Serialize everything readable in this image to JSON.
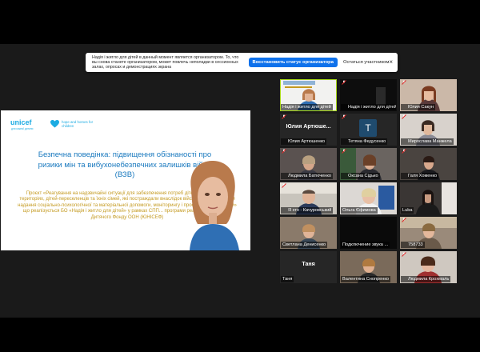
{
  "banner": {
    "message": "Надія і житло для дітей в данный момент является организатором. То, что вы снова станете организатором, может повлечь неполадки в сессионных залах, опросах и демонстрациях экрана",
    "reclaim_host_label": "Восстановить статус организатора",
    "remain_participant_label": "Остаться участником",
    "close_glyph": "×"
  },
  "slide": {
    "unicef_logo": "unicef",
    "unicef_sub": "для кожної дитини",
    "hope_logo": "hope and homes for children",
    "title": "Безпечна поведінка: підвищення обізнаності про ризики мін та вибухонебезпечних залишків війни (ВЗВ)",
    "body_1": "Проєкт «Реагування на надзвичайні ситуації для забезпечення потреб дітей на звільнених територіях, дітей-переселенців та їхніх сімей, які постраждали внаслідок військових дій, шляхом надання соціально-психологічної та матеріальної допомоги, моніторингу і просування прав дітей»",
    "body_2": "що реалізується БО «Надія і житло для дітей» у рамках СПП... програми реагування на війну Дитячого Фонду ООН (ЮНІСЕФ)"
  },
  "participants": [
    {
      "label": "Надія і житло для дітей",
      "muted": false,
      "kind": "video"
    },
    {
      "label": "Надія і житло для дітей",
      "muted": true,
      "kind": "video"
    },
    {
      "label": "Юлия Сакун",
      "muted": true,
      "kind": "video"
    },
    {
      "label": "Юлия Артюшенко",
      "muted": true,
      "kind": "name",
      "display": "Юлия Артюше..."
    },
    {
      "label": "Тетяна Федусенко",
      "muted": true,
      "kind": "avatar",
      "initial": "Т"
    },
    {
      "label": "Мирослава Манжела",
      "muted": true,
      "kind": "video"
    },
    {
      "label": "Людмила Батюченко",
      "muted": true,
      "kind": "video"
    },
    {
      "label": "Оксана Сідько",
      "muted": true,
      "kind": "video"
    },
    {
      "label": "Галя Хоменко",
      "muted": true,
      "kind": "video"
    },
    {
      "label": "Я хто - Качуровський",
      "muted": true,
      "kind": "video"
    },
    {
      "label": "Ольга Єфимова",
      "muted": false,
      "kind": "video"
    },
    {
      "label": "Luba",
      "muted": false,
      "kind": "video"
    },
    {
      "label": "Светлана Денисенко",
      "muted": false,
      "kind": "video"
    },
    {
      "label": "Подключение звука ...",
      "muted": false,
      "kind": "video"
    },
    {
      "label": "758733",
      "muted": true,
      "kind": "video"
    },
    {
      "label": "Таня",
      "muted": false,
      "kind": "name",
      "display": "Таня"
    },
    {
      "label": "Валентина Снопренко",
      "muted": false,
      "kind": "video"
    },
    {
      "label": "Людмила Крохмаль",
      "muted": true,
      "kind": "video"
    }
  ],
  "colors": {
    "active_speaker": "#a8d81b",
    "primary_button": "#0e71eb",
    "slide_title": "#1b7abf",
    "slide_body": "#c49a20",
    "brand": "#1cabe2",
    "mic_muted": "#e02828"
  }
}
